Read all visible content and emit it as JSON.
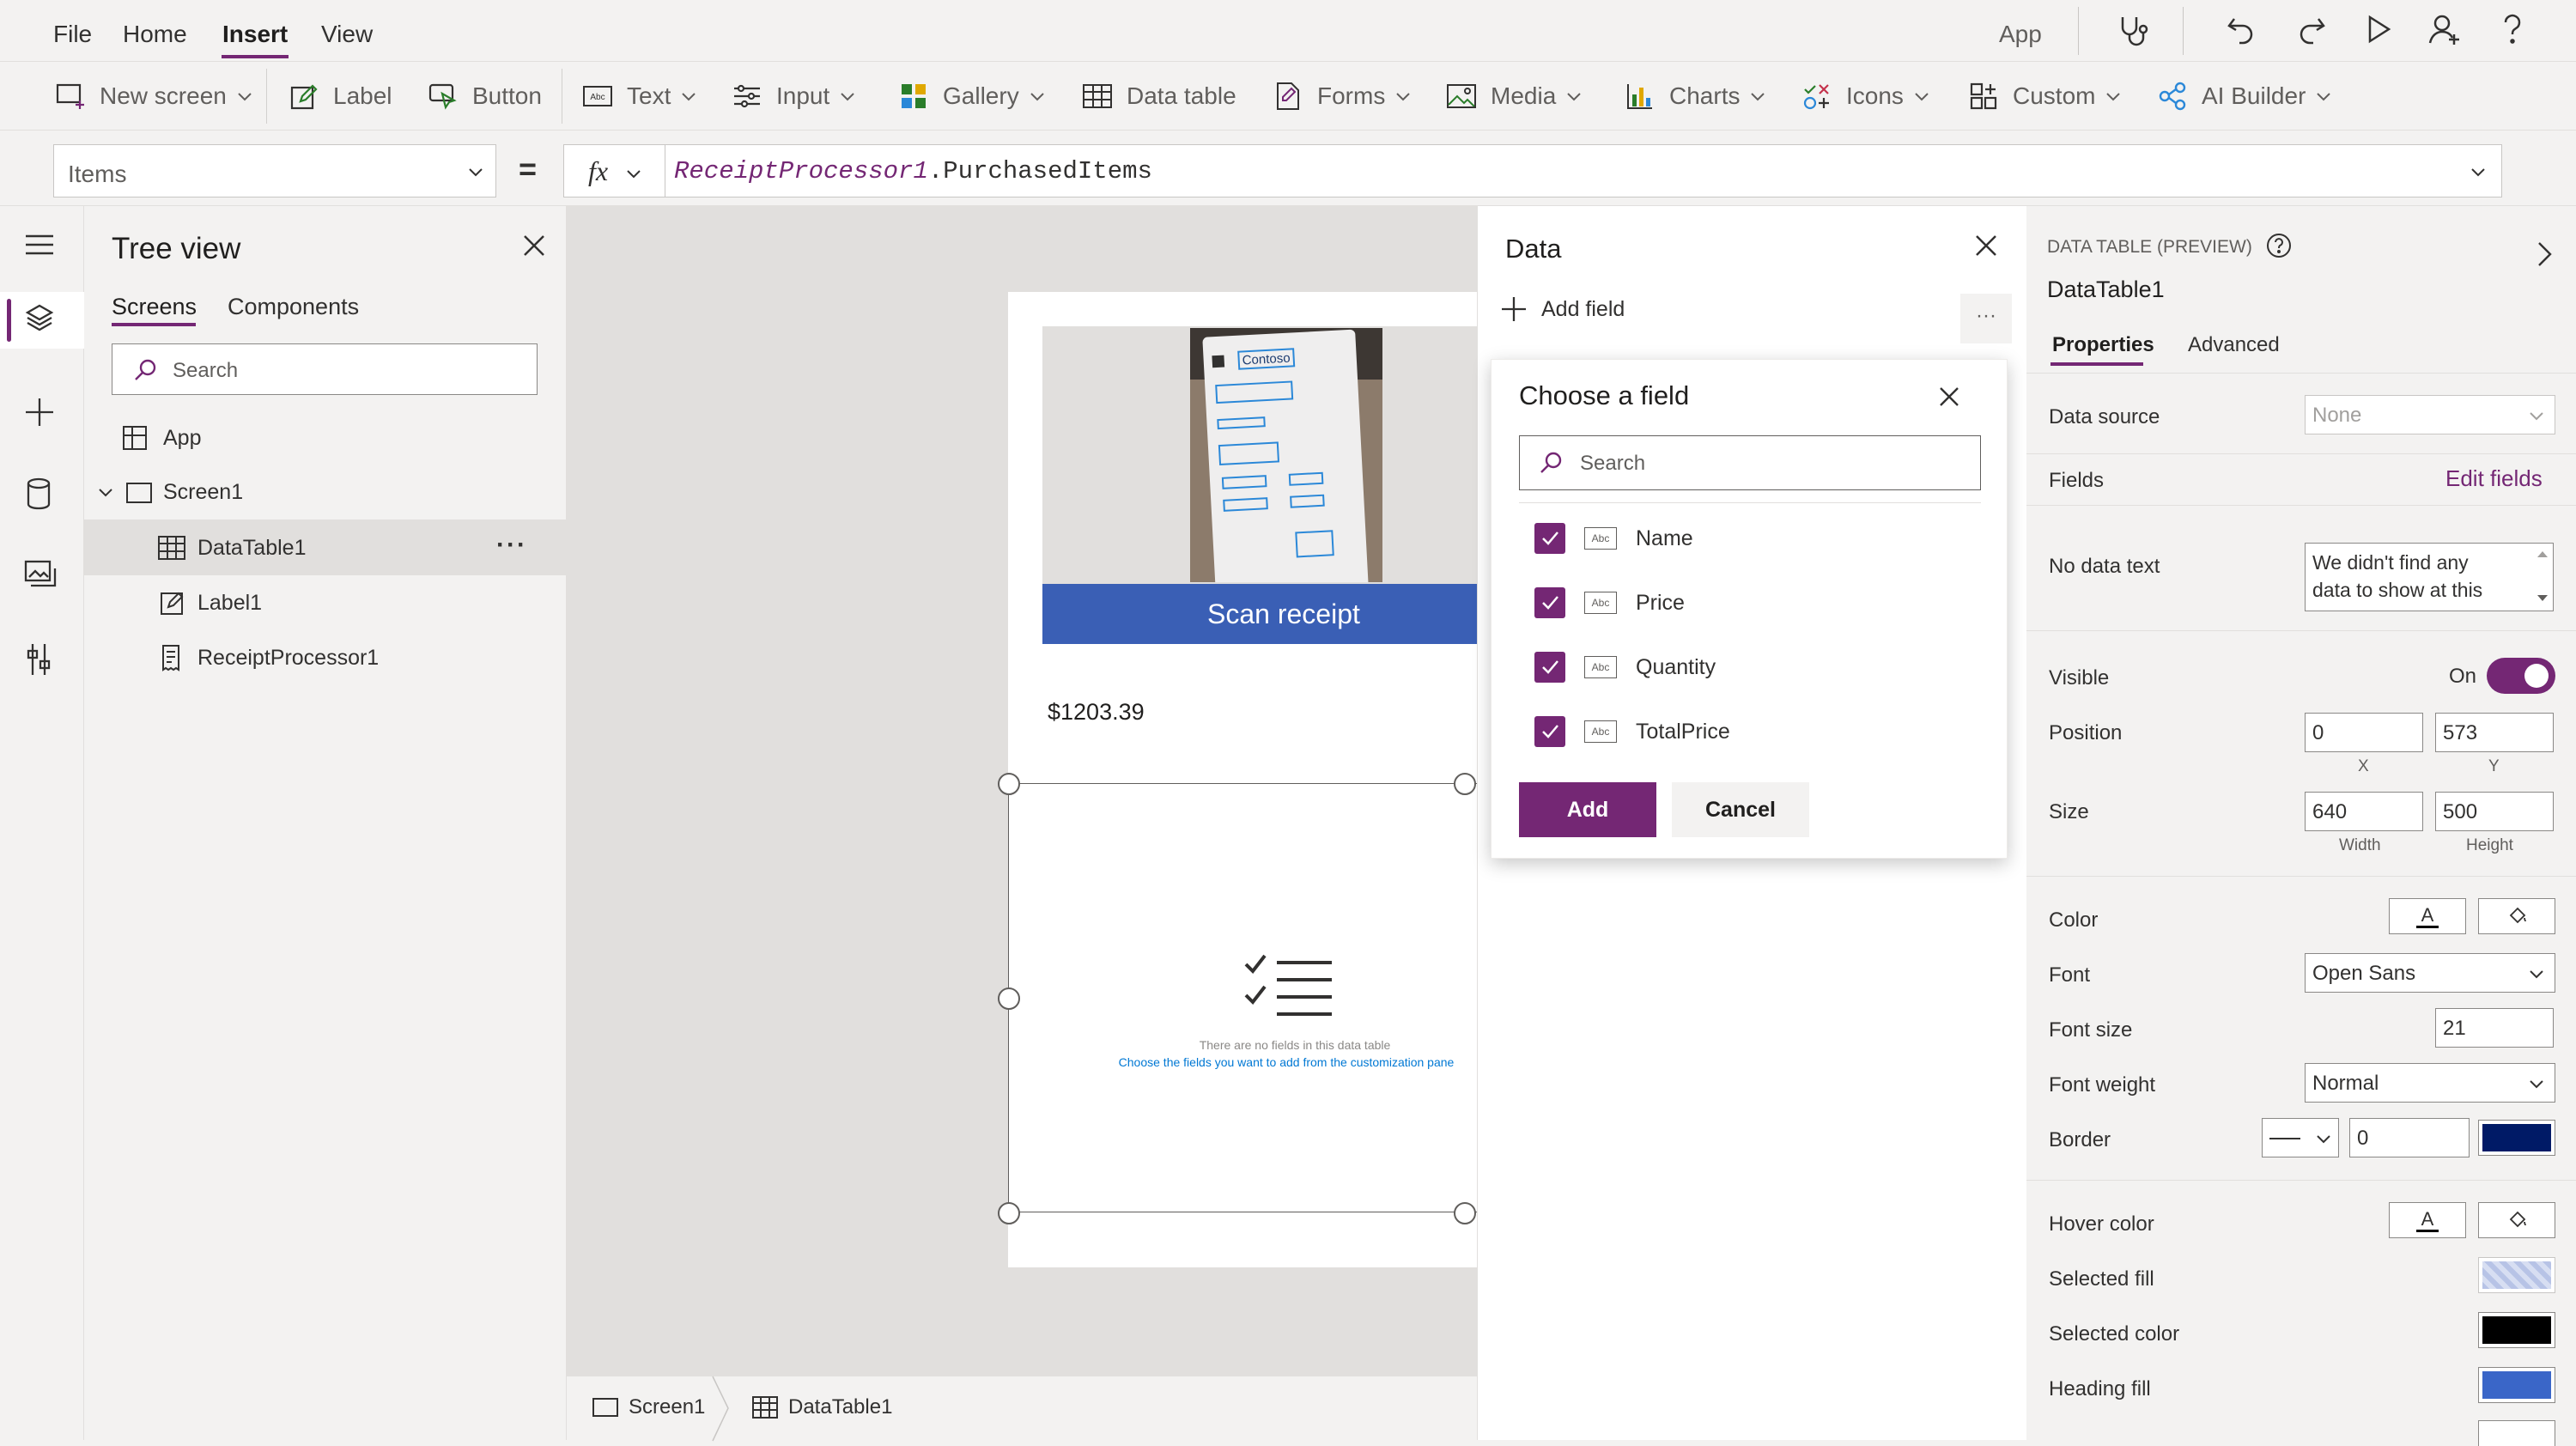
{
  "menubar": {
    "items": [
      "File",
      "Home",
      "Insert",
      "View"
    ],
    "app_label": "App"
  },
  "ribbon": {
    "new_screen": "New screen",
    "label": "Label",
    "button": "Button",
    "text": "Text",
    "input": "Input",
    "gallery": "Gallery",
    "data_table": "Data table",
    "forms": "Forms",
    "media": "Media",
    "charts": "Charts",
    "icons": "Icons",
    "custom": "Custom",
    "ai_builder": "AI Builder"
  },
  "formula": {
    "property": "Items",
    "equals": "=",
    "fx": "fx",
    "expr_object": "ReceiptProcessor1",
    "expr_rest": ".PurchasedItems"
  },
  "tree": {
    "title": "Tree view",
    "tabs": [
      "Screens",
      "Components"
    ],
    "search_placeholder": "Search",
    "items": [
      {
        "label": "App"
      },
      {
        "label": "Screen1"
      },
      {
        "label": "DataTable1"
      },
      {
        "label": "Label1"
      },
      {
        "label": "ReceiptProcessor1"
      }
    ],
    "more": "···"
  },
  "canvas": {
    "receipt_brand": "Contoso",
    "scan_button": "Scan receipt",
    "amount": "$1203.39",
    "empty_line1": "There are no fields in this data table",
    "empty_line2": "Choose the fields you want to add from the customization pane"
  },
  "status": {
    "crumbs": [
      "Screen1",
      "DataTable1"
    ]
  },
  "data_pane": {
    "title": "Data",
    "add_field": "Add field",
    "more": "···"
  },
  "flyout": {
    "title": "Choose a field",
    "search_placeholder": "Search",
    "fields": [
      "Name",
      "Price",
      "Quantity",
      "TotalPrice"
    ],
    "field_type": "Abc",
    "add": "Add",
    "cancel": "Cancel"
  },
  "props": {
    "type_label": "DATA TABLE (PREVIEW)",
    "control_name": "DataTable1",
    "tabs": [
      "Properties",
      "Advanced"
    ],
    "data_source_label": "Data source",
    "data_source_value": "None",
    "fields_label": "Fields",
    "edit_fields": "Edit fields",
    "no_data_label": "No data text",
    "no_data_value_1": "We didn't find any",
    "no_data_value_2": "data to show at this",
    "visible_label": "Visible",
    "visible_value": "On",
    "position_label": "Position",
    "pos_x": "0",
    "pos_y": "573",
    "x_caption": "X",
    "y_caption": "Y",
    "size_label": "Size",
    "width": "640",
    "height": "500",
    "width_caption": "Width",
    "height_caption": "Height",
    "color_label": "Color",
    "font_label": "Font",
    "font_value": "Open Sans",
    "font_size_label": "Font size",
    "font_size_value": "21",
    "font_weight_label": "Font weight",
    "font_weight_value": "Normal",
    "border_label": "Border",
    "border_value": "0",
    "hover_color_label": "Hover color",
    "selected_fill_label": "Selected fill",
    "selected_color_label": "Selected color",
    "heading_fill_label": "Heading fill",
    "swatch_letter": "A",
    "colors": {
      "border": "#001a66",
      "selected_color": "#000000",
      "heading_fill": "#3a66c8",
      "accent": "#742774",
      "scan_button": "#3a5fb5"
    }
  }
}
